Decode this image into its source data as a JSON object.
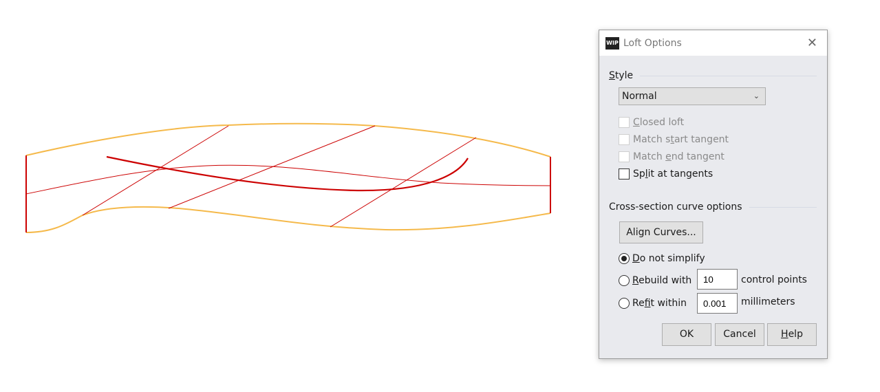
{
  "viewport": {
    "colors": {
      "surface_edge": "#f5b94a",
      "curve": "#cc0000"
    }
  },
  "dialog": {
    "title": "Loft Options",
    "icon_text": "WIP",
    "style_group": {
      "pre": "",
      "key": "S",
      "post": "tyle"
    },
    "style_value": "Normal",
    "checkboxes": [
      {
        "pre": "",
        "key": "C",
        "post": "losed loft",
        "checked": false,
        "enabled": false
      },
      {
        "pre": "Match s",
        "key": "t",
        "post": "art tangent",
        "checked": false,
        "enabled": false
      },
      {
        "pre": "Match ",
        "key": "e",
        "post": "nd tangent",
        "checked": false,
        "enabled": false
      },
      {
        "pre": "Sp",
        "key": "l",
        "post": "it at tangents",
        "checked": false,
        "enabled": true
      }
    ],
    "cross_section_group": "Cross-section curve options",
    "align_button": "Align Curves...",
    "radios": [
      {
        "pre": "",
        "key": "D",
        "post": "o not simplify",
        "selected": true
      },
      {
        "pre": "",
        "key": "R",
        "post": "ebuild with",
        "selected": false,
        "value": "10",
        "unit": "control points"
      },
      {
        "pre": "Re",
        "key": "f",
        "post": "it within",
        "selected": false,
        "value": "0.001",
        "unit": "millimeters"
      }
    ],
    "ok": "OK",
    "cancel": "Cancel",
    "help": {
      "pre": "",
      "key": "H",
      "post": "elp"
    }
  }
}
